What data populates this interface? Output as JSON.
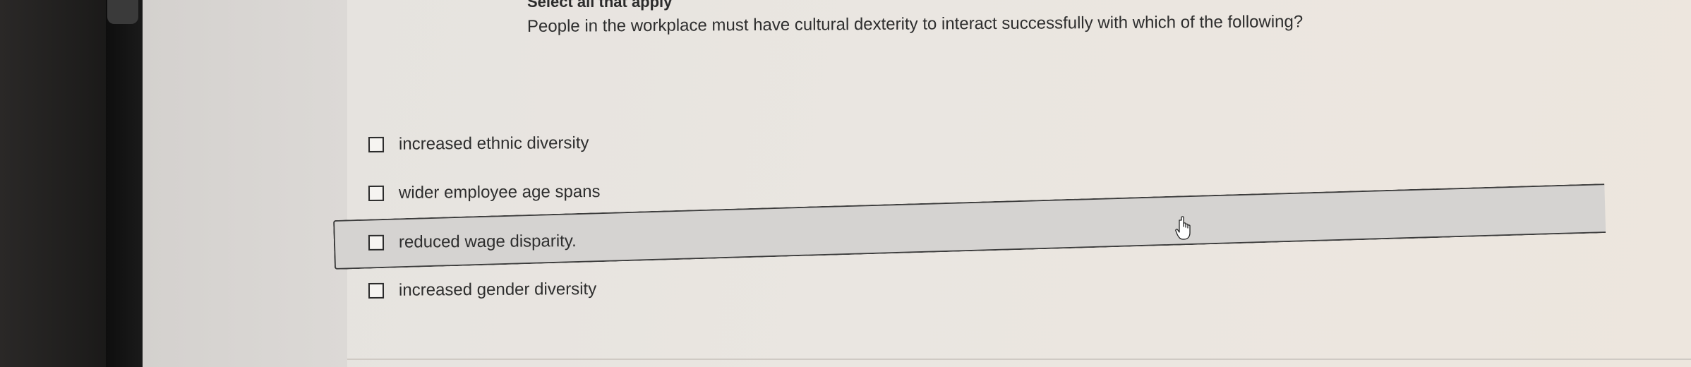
{
  "quiz": {
    "instruction": "Select all that apply",
    "question": "People in the workplace must have cultural dexterity to interact successfully with which of the following?",
    "options": [
      {
        "label": "increased ethnic diversity",
        "checked": false
      },
      {
        "label": "wider employee age spans",
        "checked": false
      },
      {
        "label": "reduced wage disparity.",
        "checked": false,
        "hovered": true
      },
      {
        "label": "increased gender diversity",
        "checked": false
      }
    ]
  },
  "cursor": {
    "icon": "hand-pointer-icon"
  }
}
